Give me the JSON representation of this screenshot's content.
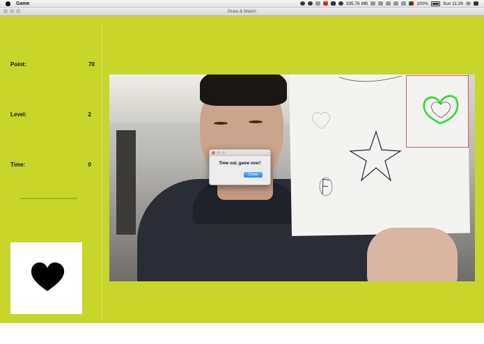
{
  "menubar": {
    "app_name": "Game",
    "memory": "335.76 MB",
    "battery": "100%",
    "clock": "Sun 11:26"
  },
  "window": {
    "title": "Draw & Match"
  },
  "stats": {
    "point_label": "Point:",
    "point_value": "70",
    "level_label": "Level:",
    "level_value": "2",
    "time_label": "Time:",
    "time_value": "0",
    "time_progress": 0
  },
  "target_shape": {
    "icon": "heart-icon",
    "color": "#000000"
  },
  "camera": {
    "matched_shape_icon": "heart-icon",
    "match_color": "#22dd22"
  },
  "dialog": {
    "message": "Time out, game over!",
    "close_label": "Close"
  },
  "colors": {
    "background": "#c8d52a",
    "dialog_button": "#2a84f2"
  }
}
